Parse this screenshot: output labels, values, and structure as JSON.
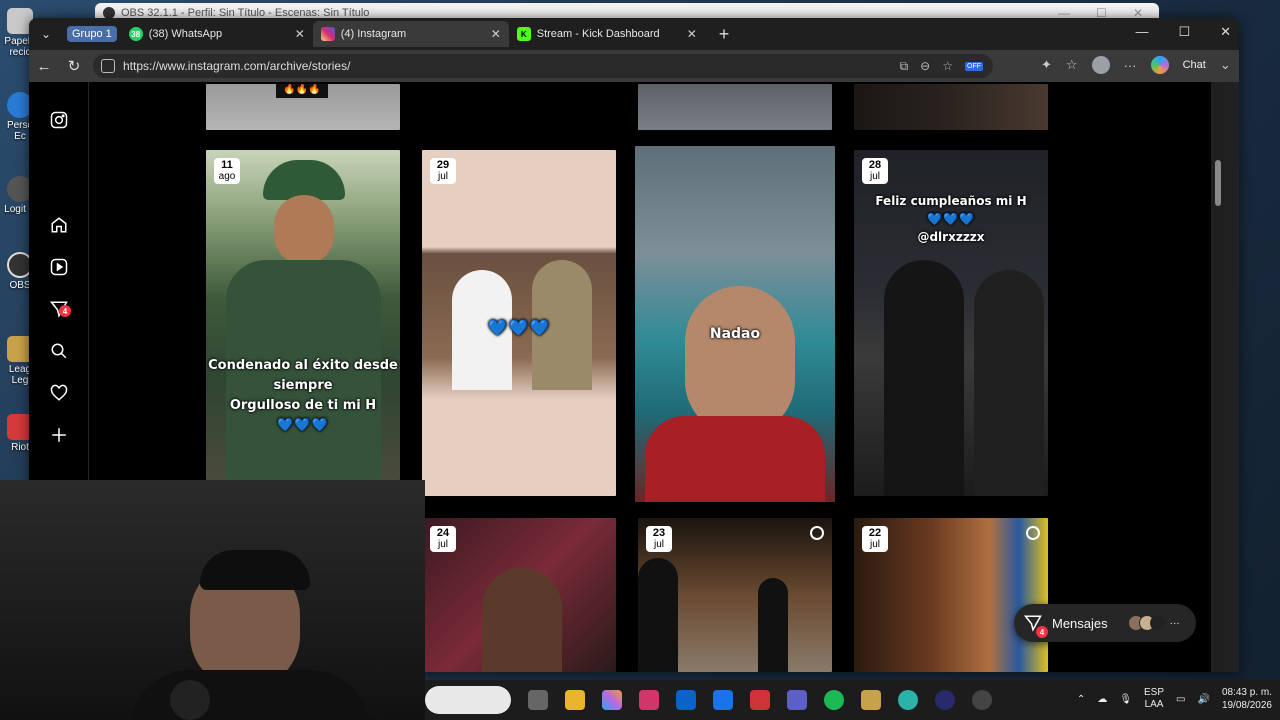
{
  "desktop": {
    "icons": [
      {
        "label": "Papele recic",
        "color": "#c9c9c9"
      },
      {
        "label": "Perso Ec",
        "color": "#2a7bd6"
      },
      {
        "label": "Logit H",
        "color": "#555"
      },
      {
        "label": "OBS",
        "color": "#333"
      },
      {
        "label": "Leag Leg",
        "color": "#c8a24a"
      },
      {
        "label": "Riot",
        "color": "#d43a3a"
      }
    ]
  },
  "obs": {
    "title": "OBS 32.1.1 - Perfil: Sin Título - Escenas: Sin Título"
  },
  "browser": {
    "group_label": "Grupo 1",
    "tabs": [
      {
        "title": "(38) WhatsApp",
        "favicon_color": "#25d366",
        "favicon_text": "38"
      },
      {
        "title": "(4) Instagram",
        "favicon_color": "#d6249f",
        "favicon_text": ""
      },
      {
        "title": "Stream - Kick Dashboard",
        "favicon_color": "#53fc18",
        "favicon_text": "K"
      }
    ],
    "url": "https://www.instagram.com/archive/stories/",
    "chat_label": "Chat",
    "off_badge": "OFF"
  },
  "stories": [
    {
      "day": "11",
      "month": "ago",
      "caption_lines": [
        "Condenado al éxito desde",
        "siempre",
        "Orgulloso de ti mi H"
      ],
      "hearts": "💙💙💙"
    },
    {
      "day": "29",
      "month": "jul",
      "caption_lines": [],
      "hearts": "💙💙💙"
    },
    {
      "day": "",
      "month": "",
      "caption_lines": [
        "Nadao"
      ],
      "hearts": ""
    },
    {
      "day": "28",
      "month": "jul",
      "caption_lines": [
        "Feliz cumpleaños mi H",
        "@dlrxzzzx"
      ],
      "hearts": "💙💙💙"
    },
    {
      "day": "24",
      "month": "jul",
      "caption_lines": [],
      "hearts": ""
    },
    {
      "day": "23",
      "month": "jul",
      "caption_lines": [],
      "hearts": ""
    },
    {
      "day": "22",
      "month": "jul",
      "caption_lines": [],
      "hearts": ""
    }
  ],
  "top_row_partial": {
    "emoji": "🔥🔥🔥"
  },
  "messages_pill": {
    "label": "Mensajes",
    "badge": "4",
    "more": "···"
  },
  "sidebar": {
    "notif_badge": "4"
  },
  "taskbar": {
    "lang": "ESP",
    "lang_sub": "LAA",
    "time": "08:43 p. m.",
    "date": "19/08/2026"
  }
}
